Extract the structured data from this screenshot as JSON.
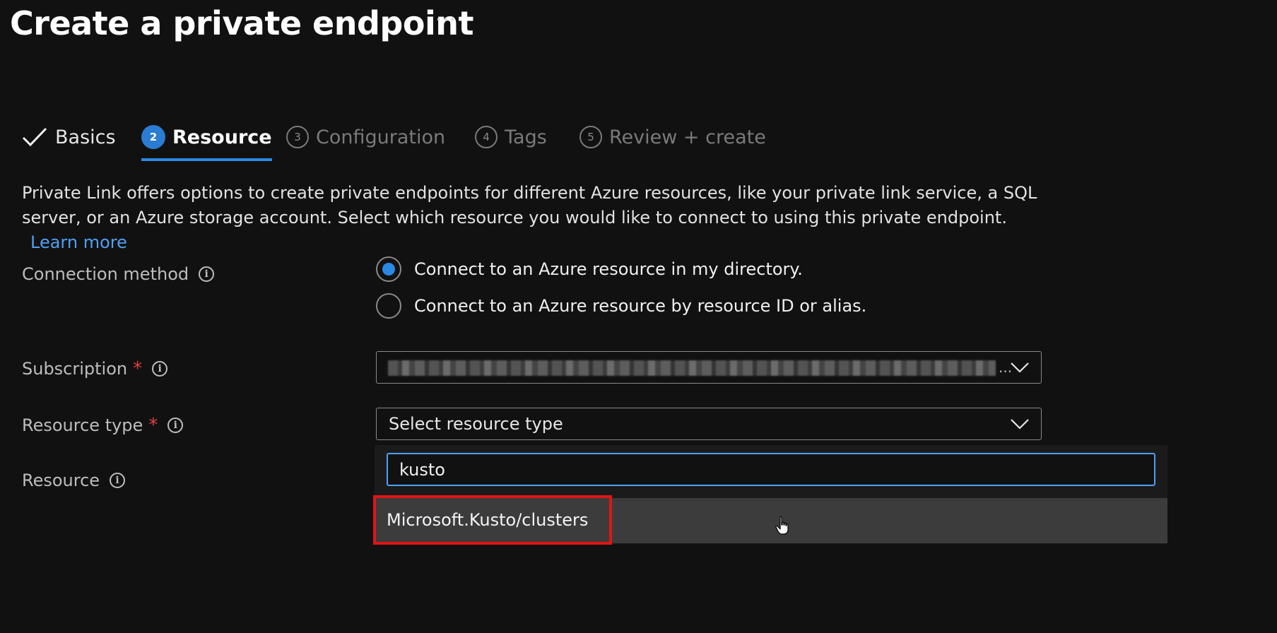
{
  "page": {
    "title": "Create a private endpoint",
    "more_label": "···"
  },
  "wizard": {
    "tabs": [
      {
        "label": "Basics",
        "state": "completed"
      },
      {
        "number": "2",
        "label": "Resource",
        "state": "active"
      },
      {
        "number": "3",
        "label": "Configuration",
        "state": "disabled"
      },
      {
        "number": "4",
        "label": "Tags",
        "state": "disabled"
      },
      {
        "number": "5",
        "label": "Review + create",
        "state": "disabled"
      }
    ]
  },
  "description": {
    "text": "Private Link offers options to create private endpoints for different Azure resources, like your private link service, a SQL server, or an Azure storage account. Select which resource you would like to connect to using this private endpoint.",
    "learn_more": "Learn more"
  },
  "form": {
    "connection_method": {
      "label": "Connection method",
      "options": [
        {
          "label": "Connect to an Azure resource in my directory.",
          "selected": true
        },
        {
          "label": "Connect to an Azure resource by resource ID or alias.",
          "selected": false
        }
      ]
    },
    "subscription": {
      "label": "Subscription",
      "required_mark": "*",
      "value_ellipsis": "..."
    },
    "resource_type": {
      "label": "Resource type",
      "required_mark": "*",
      "placeholder": "Select resource type",
      "filter_value": "kusto",
      "options": [
        "Microsoft.Kusto/clusters"
      ]
    },
    "resource": {
      "label": "Resource"
    }
  },
  "colors": {
    "accent": "#2b88e3",
    "link": "#4ea0f5",
    "required": "#e04040",
    "highlight": "#e01515"
  }
}
